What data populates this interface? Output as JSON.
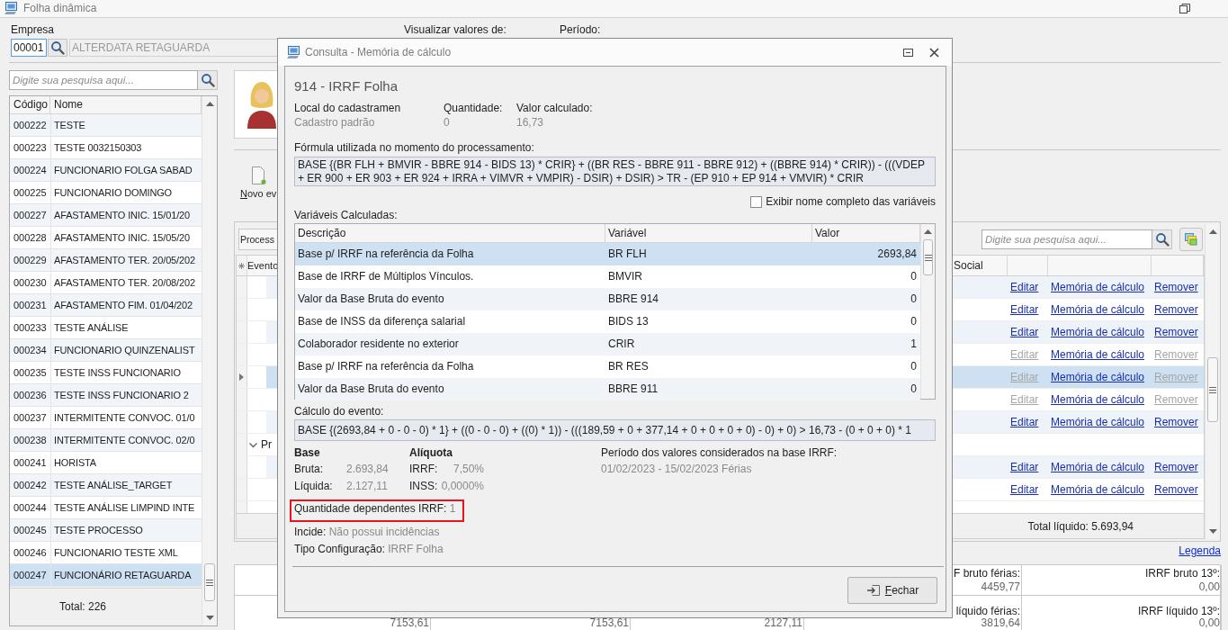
{
  "window": {
    "title": "Folha dinâmica"
  },
  "company": {
    "label": "Empresa",
    "code": "00001",
    "name": "ALTERDATA RETAGUARDA",
    "view_label": "Visualizar valores de:",
    "period_label": "Período:"
  },
  "employees": {
    "search": {
      "placeholder": "Digite sua pesquisa aqui..."
    },
    "columns": [
      "Código",
      "Nome"
    ],
    "rows": [
      {
        "code": "000222",
        "name": "TESTE",
        "selected": false
      },
      {
        "code": "000223",
        "name": "TESTE 0032150303",
        "selected": false
      },
      {
        "code": "000224",
        "name": "FUNCIONARIO FOLGA SABAD",
        "selected": false
      },
      {
        "code": "000225",
        "name": "FUNCIONARIO DOMINGO",
        "selected": false
      },
      {
        "code": "000227",
        "name": "AFASTAMENTO INIC. 15/01/20",
        "selected": false
      },
      {
        "code": "000228",
        "name": "AFASTAMENTO INIC. 15/05/20",
        "selected": false
      },
      {
        "code": "000229",
        "name": "AFASTAMENTO TER. 20/05/202",
        "selected": false
      },
      {
        "code": "000230",
        "name": "AFASTAMENTO TER. 20/08/202",
        "selected": false
      },
      {
        "code": "000231",
        "name": "AFASTAMENTO FIM. 01/04/202",
        "selected": false
      },
      {
        "code": "000233",
        "name": "TESTE ANÁLISE",
        "selected": false
      },
      {
        "code": "000234",
        "name": "FUNCIONARIO QUINZENALIST",
        "selected": false
      },
      {
        "code": "000235",
        "name": "TESTE INSS FUNCIONARIO",
        "selected": false
      },
      {
        "code": "000236",
        "name": "TESTE INSS FUNCIONARIO 2",
        "selected": false
      },
      {
        "code": "000237",
        "name": "INTERMITENTE CONVOC. 01/0",
        "selected": false
      },
      {
        "code": "000238",
        "name": "INTERMITENTE CONVOC. 02/0",
        "selected": false
      },
      {
        "code": "000241",
        "name": "HORISTA",
        "selected": false
      },
      {
        "code": "000242",
        "name": "TESTE ANÁLISE_TARGET",
        "selected": false
      },
      {
        "code": "000244",
        "name": "TESTE ANÁLISE LIMPIND INTE",
        "selected": false
      },
      {
        "code": "000245",
        "name": "TESTE PROCESSO",
        "selected": false
      },
      {
        "code": "000246",
        "name": "FUNCIONARIO TESTE XML",
        "selected": false
      },
      {
        "code": "000247",
        "name": "FUNCIONÁRIO RETAGUARDA",
        "selected": true
      }
    ],
    "total": "Total: 226"
  },
  "toolbar": {
    "new_event": "Novo ev"
  },
  "events": {
    "filter": "Process",
    "search": {
      "placeholder": "Digite sua pesquisa aqui..."
    },
    "columns": [
      "Evento",
      "Social"
    ],
    "rows": [
      {
        "kind": "event",
        "selected": false,
        "actions": [
          {
            "label": "Editar",
            "disabled": false
          },
          {
            "label": "Memória de cálculo",
            "disabled": false
          },
          {
            "label": "Remover",
            "disabled": false
          }
        ]
      },
      {
        "kind": "event",
        "selected": false,
        "actions": [
          {
            "label": "Editar",
            "disabled": false
          },
          {
            "label": "Memória de cálculo",
            "disabled": false
          },
          {
            "label": "Remover",
            "disabled": false
          }
        ]
      },
      {
        "kind": "event",
        "selected": false,
        "actions": [
          {
            "label": "Editar",
            "disabled": false
          },
          {
            "label": "Memória de cálculo",
            "disabled": false
          },
          {
            "label": "Remover",
            "disabled": false
          }
        ]
      },
      {
        "kind": "event",
        "selected": false,
        "actions": [
          {
            "label": "Editar",
            "disabled": true
          },
          {
            "label": "Memória de cálculo",
            "disabled": false
          },
          {
            "label": "Remover",
            "disabled": true
          }
        ]
      },
      {
        "kind": "event",
        "selected": true,
        "actions": [
          {
            "label": "Editar",
            "disabled": true
          },
          {
            "label": "Memória de cálculo",
            "disabled": false
          },
          {
            "label": "Remover",
            "disabled": true
          }
        ]
      },
      {
        "kind": "event",
        "selected": false,
        "actions": [
          {
            "label": "Editar",
            "disabled": true
          },
          {
            "label": "Memória de cálculo",
            "disabled": false
          },
          {
            "label": "Remover",
            "disabled": true
          }
        ]
      },
      {
        "kind": "event",
        "selected": false,
        "actions": [
          {
            "label": "Editar",
            "disabled": false
          },
          {
            "label": "Memória de cálculo",
            "disabled": false
          },
          {
            "label": "Remover",
            "disabled": false
          }
        ]
      },
      {
        "kind": "group",
        "label": "Pr",
        "expanded": true
      },
      {
        "kind": "event",
        "selected": false,
        "actions": [
          {
            "label": "Editar",
            "disabled": false
          },
          {
            "label": "Memória de cálculo",
            "disabled": false
          },
          {
            "label": "Remover",
            "disabled": false
          }
        ]
      },
      {
        "kind": "event",
        "selected": false,
        "actions": [
          {
            "label": "Editar",
            "disabled": false
          },
          {
            "label": "Memória de cálculo",
            "disabled": false
          },
          {
            "label": "Remover",
            "disabled": false
          }
        ]
      }
    ],
    "total": "Total líquido: 5.693,94"
  },
  "legend_link": "Legenda",
  "summary": {
    "rows": [
      {
        "cells": [
          {},
          {},
          {},
          {
            "label": "F bruto férias:",
            "value": "4459,77"
          },
          {
            "label": "IRRF bruto 13º:",
            "value": "0,00"
          }
        ]
      },
      {
        "cells": [
          {
            "value": "7153,61"
          },
          {
            "value": "7153,61"
          },
          {
            "value": "2127,11"
          },
          {
            "label": "líquido férias:",
            "value": "3819,64"
          },
          {
            "label": "IRRF líquido 13º:",
            "value": "0,00"
          }
        ]
      }
    ]
  },
  "dialog": {
    "title": "Consulta - Memória de cálculo",
    "heading": "914 - IRRF Folha",
    "fields": [
      {
        "label": "Local do cadastramen",
        "value": "Cadastro padrão"
      },
      {
        "label": "Quantidade:",
        "value": "0"
      },
      {
        "label": "Valor calculado:",
        "value": "16,73"
      }
    ],
    "formula_label": "Fórmula utilizada no momento do processamento:",
    "formula": "BASE {(BR FLH + BMVIR - BBRE 914 - BIDS 13) * CRIR} + ((BR RES - BBRE 911 - BBRE 912) + ((BBRE 914) * CRIR)) - (((VDEP + ER 900 + ER 903 + ER 924 + IRRA + VIMVR + VMPIR) - DSIR) + DSIR) > TR - (EP 910 + EP 914 + VMVIR) * CRIR",
    "show_full_names": {
      "label": "Exibir nome completo das variáveis",
      "checked": false
    },
    "variables_label": "Variáveis Calculadas:",
    "variables": {
      "columns": [
        "Descrição",
        "Variável",
        "Valor"
      ],
      "rows": [
        {
          "description": "Base p/ IRRF na referência da Folha",
          "variable": "BR FLH",
          "value": "2693,84",
          "selected": true
        },
        {
          "description": "Base de IRRF de Múltiplos Vínculos.",
          "variable": "BMVIR",
          "value": "0",
          "selected": false
        },
        {
          "description": "Valor da Base Bruta do evento",
          "variable": "BBRE 914",
          "value": "0",
          "selected": false
        },
        {
          "description": "Base de INSS da diferença salarial",
          "variable": "BIDS 13",
          "value": "0",
          "selected": false
        },
        {
          "description": "Colaborador residente no exterior",
          "variable": "CRIR",
          "value": "1",
          "selected": false
        },
        {
          "description": "Base p/ IRRF na referência da Folha",
          "variable": "BR RES",
          "value": "0",
          "selected": false
        },
        {
          "description": "Valor da Base Bruta do evento",
          "variable": "BBRE 911",
          "value": "0",
          "selected": false
        }
      ]
    },
    "calculation_label": "Cálculo do evento:",
    "calculation": "BASE {(2693,84 + 0 - 0 - 0) * 1} + ((0 - 0 - 0) + ((0) * 1)) - (((189,59 + 0 + 377,14 + 0 + 0 + 0 + 0) - 0) + 0) > 16,73 - (0 + 0 + 0) * 1",
    "base": {
      "title": "Base",
      "rows": [
        {
          "label": "Bruta:",
          "value": "2.693,84"
        },
        {
          "label": "Líquida:",
          "value": "2.127,11"
        }
      ]
    },
    "rate": {
      "title": "Alíquota",
      "rows": [
        {
          "label": "IRRF:",
          "value": "7,50%"
        },
        {
          "label": "INSS:",
          "value": "0,0000%"
        }
      ]
    },
    "period": {
      "title": "Período dos valores considerados na base IRRF:",
      "value": "01/02/2023 - 15/02/2023 Férias"
    },
    "details": [
      {
        "label": "Quantidade dependentes IRRF:",
        "value": "1",
        "highlighted": true
      },
      {
        "label": "Incide:",
        "value": "Não possui incidências",
        "highlighted": false
      },
      {
        "label": "Tipo Configuração:",
        "value": "IRRF Folha",
        "highlighted": false
      }
    ],
    "close_button": "Fechar"
  }
}
